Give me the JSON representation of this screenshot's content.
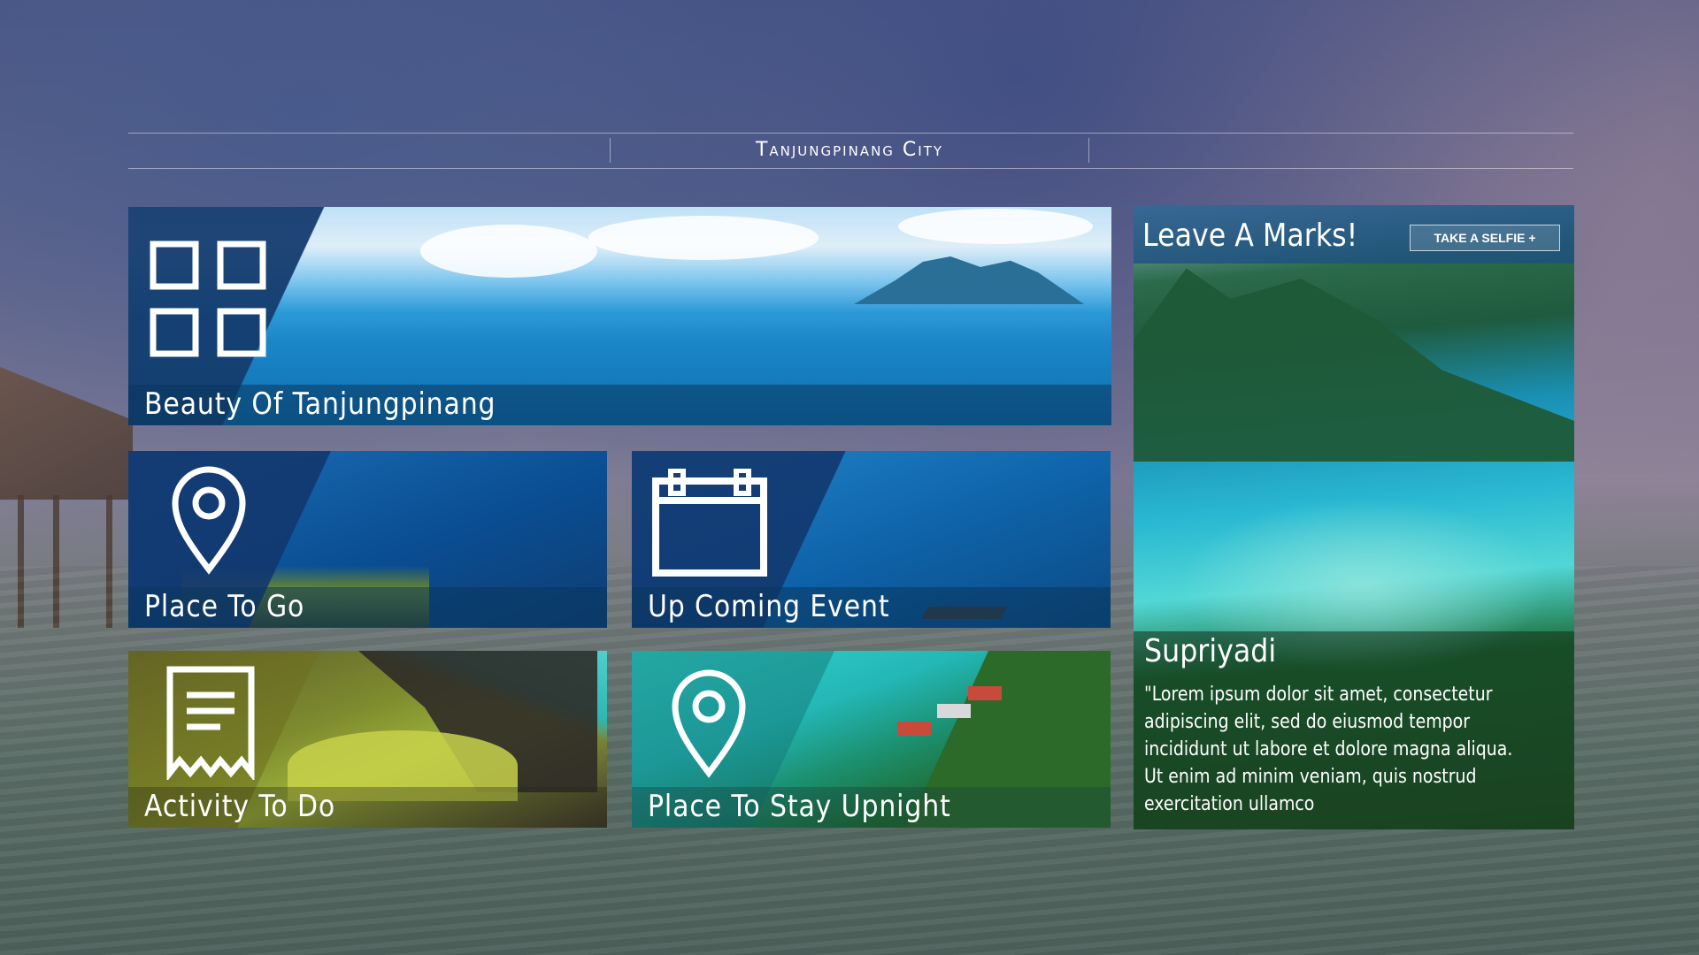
{
  "header": {
    "title": "Tanjungpinang City"
  },
  "tiles": {
    "hero": {
      "label": "Beauty Of Tanjungpinang",
      "icon": "grid-icon"
    },
    "place_to_go": {
      "label": "Place To Go",
      "icon": "map-pin-icon"
    },
    "upcoming_event": {
      "label": "Up Coming Event",
      "icon": "calendar-icon"
    },
    "activity": {
      "label": "Activity To Do",
      "icon": "receipt-icon"
    },
    "place_to_stay": {
      "label": "Place To Stay Upnight",
      "icon": "map-pin-icon"
    }
  },
  "marks_panel": {
    "title": "Leave A Marks!",
    "button_label": "TAKE A SELFIE +",
    "author": "Supriyadi",
    "quote": "\"Lorem ipsum dolor sit amet, consectetur adipiscing elit, sed do eiusmod tempor incididunt ut labore et dolore magna aliqua. Ut enim ad minim veniam, quis nostrud exercitation ullamco"
  },
  "colors": {
    "tile_overlay": "#12376e",
    "label_bar": "#0a375f"
  }
}
